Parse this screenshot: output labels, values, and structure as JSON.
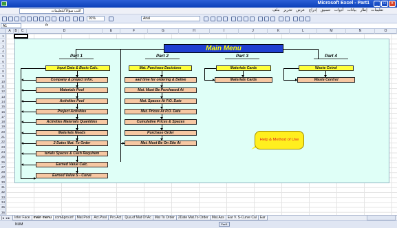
{
  "window": {
    "title": "Microsoft Excel - Part1",
    "help_placeholder": "اكتب سؤالاً للتعليمات",
    "menus": [
      "ملف",
      "تحرير",
      "عرض",
      "إدراج",
      "تنسيق",
      "أدوات",
      "بيانات",
      "إطار",
      "تعليمات"
    ]
  },
  "toolbar": {
    "font_name": "Arial",
    "zoom": "91%"
  },
  "formula_bar": {
    "cell_ref": "A1",
    "fx": "fx"
  },
  "columns": [
    "A",
    "B",
    "C",
    "D",
    "E",
    "F",
    "G",
    "H",
    "I",
    "J",
    "K",
    "L",
    "M",
    "N",
    "O"
  ],
  "rows": [
    "1",
    "2",
    "3",
    "4",
    "5",
    "6",
    "7",
    "8",
    "9",
    "10",
    "11",
    "12",
    "13",
    "14",
    "15",
    "16",
    "17",
    "18",
    "19",
    "20",
    "21",
    "22",
    "23",
    "24",
    "25",
    "26",
    "27",
    "28",
    "29",
    "30",
    "31",
    "32",
    "33",
    "34",
    "35",
    "36"
  ],
  "main_menu": "Main Menu",
  "parts": {
    "part1": {
      "title": "Part 1",
      "header": "Input Data & Basic Calc.",
      "items": [
        "Company & project Infor.",
        "Materials Pool",
        "Activities Pool",
        "Project Activities",
        "Activities Materials Quantities",
        "Materials Needs",
        "2 Dates Mat. To Order",
        "terials Spaces & Cash Requirem",
        "Earned Value Calc.",
        "Earned Value S - Curve"
      ]
    },
    "part2": {
      "title": "Part 2",
      "header": "Mat. Purchase Decisions",
      "items": [
        "aad time for ordering & Delive",
        "Mat. Must Be Purchased At",
        "Mat. Spaces At P.O. Date",
        "Mat. Prices At P.O. Date",
        "Cumulative Prices & Spaces",
        "Purchase Order",
        "Mat. Must Be On Site At"
      ]
    },
    "part3": {
      "title": "Part 3",
      "header": "Materials Cards",
      "items": [
        "Materials Cards"
      ]
    },
    "part4": {
      "title": "Part 4",
      "header": "Waste Cntrol",
      "items": [
        "Waste Control"
      ]
    }
  },
  "help_callout": "Help & Method of Use",
  "sheet_tabs": [
    "Inter Face",
    "main menu",
    "com&pro.inf",
    "Mat.Pool",
    "Act.Pool",
    "Pro.Act",
    "Qua.of Mat Of Ac",
    "Mat To Order",
    "2Date Mat.To Order",
    "Mat.Ass",
    "Ear V. S-Curve Cal",
    "Ear"
  ],
  "active_tab": "main menu",
  "status": {
    "mode": "NUM",
    "box": "Part1"
  },
  "colors": {
    "canvas_bg": "#dffff7",
    "main_menu_bg": "#1f3fd1",
    "main_menu_text": "#ffff00",
    "header_btn": "#ffff3a",
    "item_btn": "#f6c7a2",
    "callout": "#ffef1f",
    "title_bar": "#0a3fb8"
  }
}
